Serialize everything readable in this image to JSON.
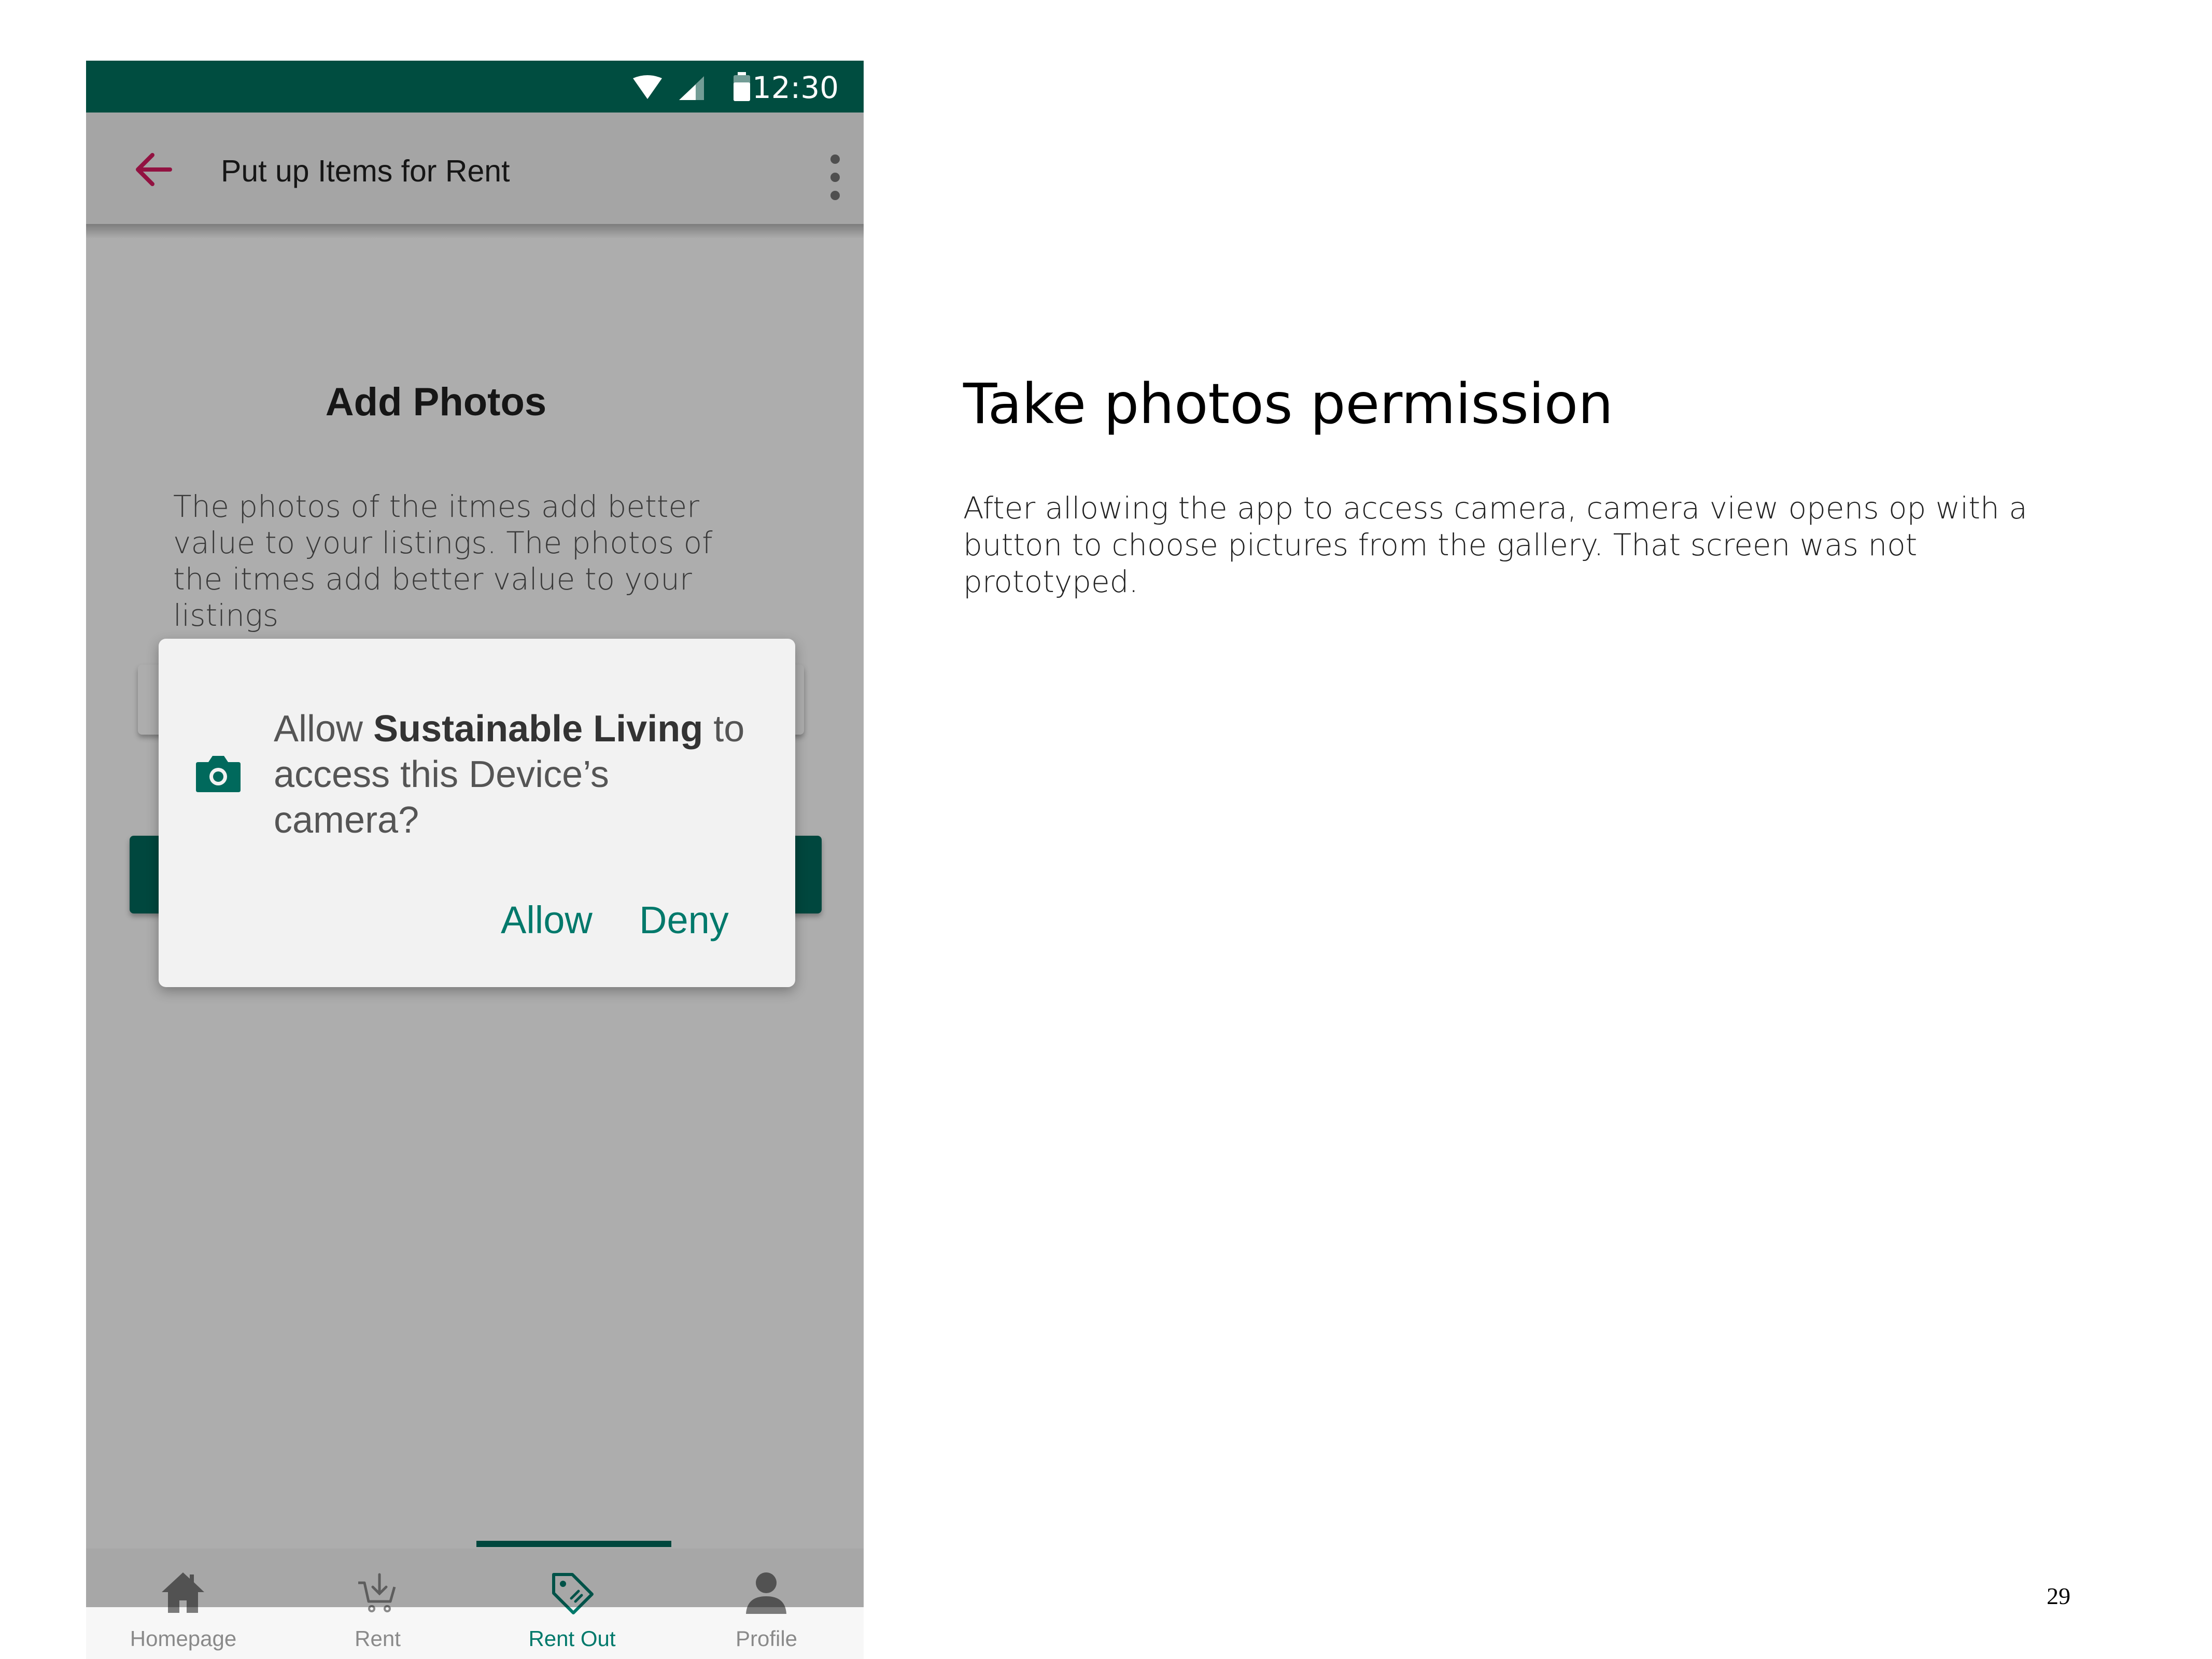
{
  "status_bar": {
    "time": "12:30"
  },
  "app_bar": {
    "title": "Put up Items for Rent"
  },
  "content": {
    "heading": "Add Photos",
    "description": "The photos of the itmes add better value to your listings. The photos of the itmes add better value to your listings"
  },
  "dialog": {
    "prefix": "Allow ",
    "app_name": "Sustainable Living",
    "suffix": " to access this Device’s camera?",
    "allow_label": "Allow",
    "deny_label": "Deny"
  },
  "bottom_nav": {
    "items": [
      {
        "label": "Homepage",
        "icon": "home-icon",
        "active": false
      },
      {
        "label": "Rent",
        "icon": "cart-icon",
        "active": false
      },
      {
        "label": "Rent Out",
        "icon": "tag-icon",
        "active": true
      },
      {
        "label": "Profile",
        "icon": "person-icon",
        "active": false
      }
    ]
  },
  "annotation": {
    "title": "Take photos permission",
    "body": "After allowing the app to access camera, camera view opens op with a button to choose pictures from the gallery. That screen was not prototyped."
  },
  "page_number": "29",
  "colors": {
    "status_bar": "#004d40",
    "accent": "#00796b",
    "back_arrow": "#d81b60",
    "scrim": "rgba(0,0,0,0.32)"
  }
}
